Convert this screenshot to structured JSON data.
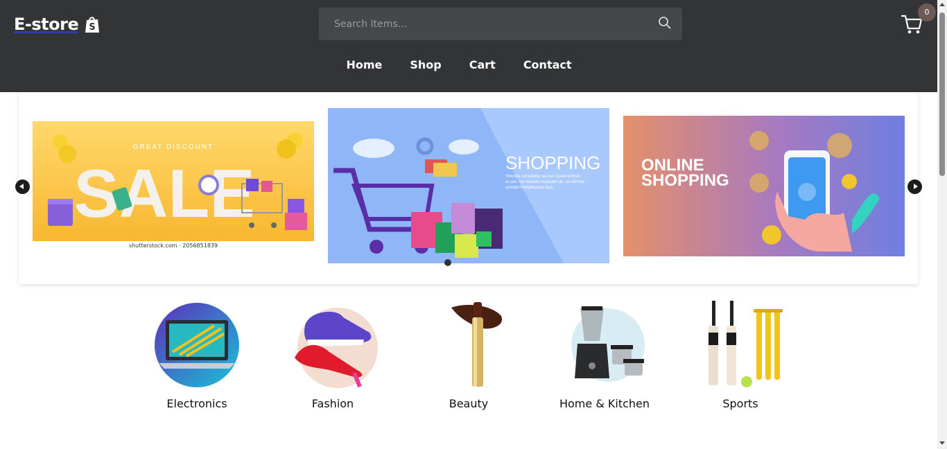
{
  "header": {
    "logo": "E-store",
    "search_placeholder": "Search Items...",
    "cart_count": "0",
    "nav": [
      "Home",
      "Shop",
      "Cart",
      "Contact"
    ]
  },
  "carousel": {
    "banners": [
      {
        "kicker": "GREAT DISCOUNT",
        "headline": "SALE",
        "caption": "shutterstock.com · 2056851839"
      },
      {
        "headline": "SHOPPING",
        "body": "Vivendo consetetur ea nec Quod eirmod ex per, vix nemore nusquam an, no eirmod suscipit theophrastus duo."
      },
      {
        "headline_line1": "ONLINE",
        "headline_line2": "SHOPPING"
      }
    ]
  },
  "categories": [
    {
      "label": "Electronics",
      "icon": "laptop-icon"
    },
    {
      "label": "Fashion",
      "icon": "shoe-icon"
    },
    {
      "label": "Beauty",
      "icon": "lipstick-icon"
    },
    {
      "label": "Home & Kitchen",
      "icon": "mixer-grinder-icon"
    },
    {
      "label": "Sports",
      "icon": "cricket-bat-icon"
    }
  ],
  "colors": {
    "header_bg": "#323436",
    "search_bg": "#454749",
    "badge_bg": "#6d5a54"
  }
}
